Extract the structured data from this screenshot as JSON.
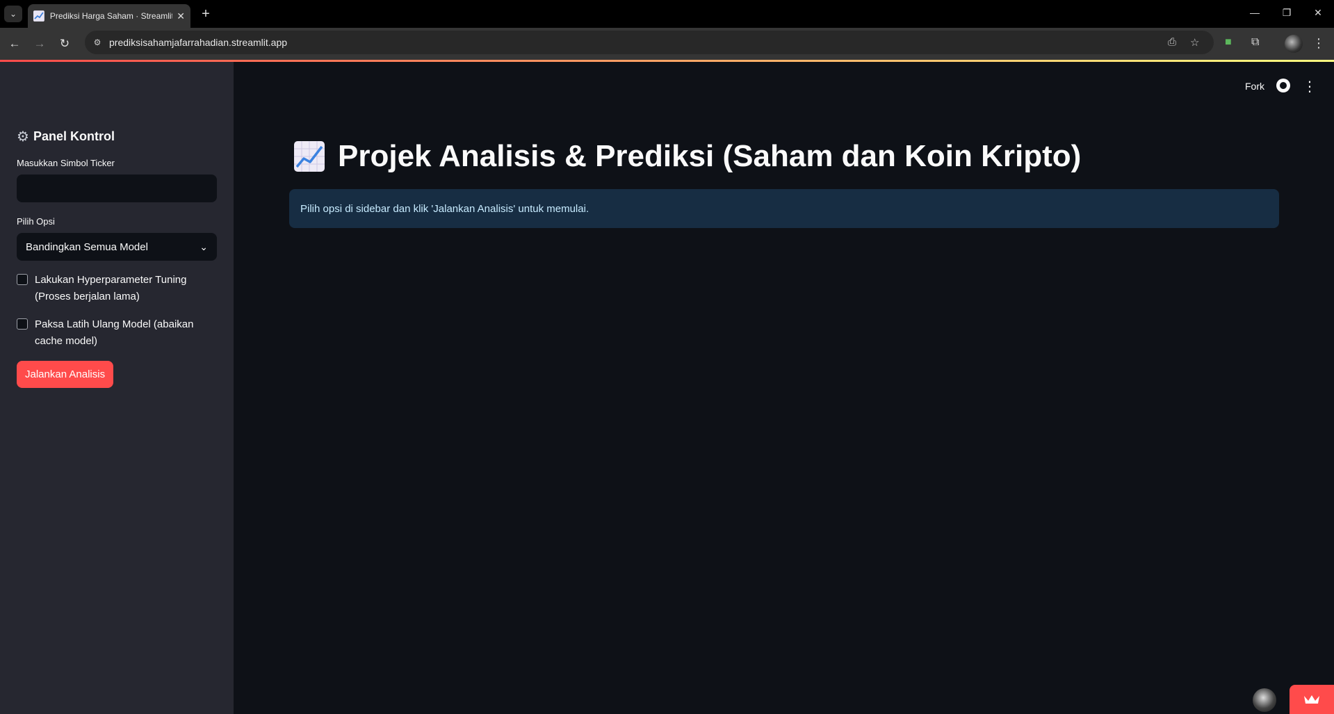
{
  "browser": {
    "tab_title": "Prediksi Harga Saham · Streamlit",
    "url": "prediksisahamjafarrahadian.streamlit.app"
  },
  "sidebar": {
    "title": "Panel Kontrol",
    "ticker_label": "Masukkan Simbol Ticker",
    "ticker_value": "",
    "option_label": "Pilih Opsi",
    "option_selected": "Bandingkan Semua Model",
    "checkbox1_label": "Lakukan Hyperparameter Tuning (Proses berjalan lama)",
    "checkbox1_checked": false,
    "checkbox2_label": "Paksa Latih Ulang Model (abaikan cache model)",
    "checkbox2_checked": false,
    "run_button": "Jalankan Analisis"
  },
  "header": {
    "fork_label": "Fork"
  },
  "main": {
    "title": "Projek Analisis & Prediksi (Saham dan Koin Kripto)",
    "info": "Pilih opsi di sidebar dan klik 'Jalankan Analisis' untuk memulai."
  },
  "colors": {
    "accent": "#ff4b4b",
    "background": "#0e1117",
    "sidebar": "#262730",
    "info_bg": "#172d43"
  },
  "icons": [
    "tab-list-icon",
    "favicon-chart-icon",
    "close-icon",
    "plus-icon",
    "minimize-icon",
    "restore-icon",
    "window-close-icon",
    "back-icon",
    "forward-icon",
    "reload-icon",
    "site-info-icon",
    "install-icon",
    "star-icon",
    "extension-icon",
    "puzzle-icon",
    "gear-icon",
    "chevron-down-icon",
    "github-icon",
    "kebab-menu-icon",
    "crown-icon"
  ]
}
